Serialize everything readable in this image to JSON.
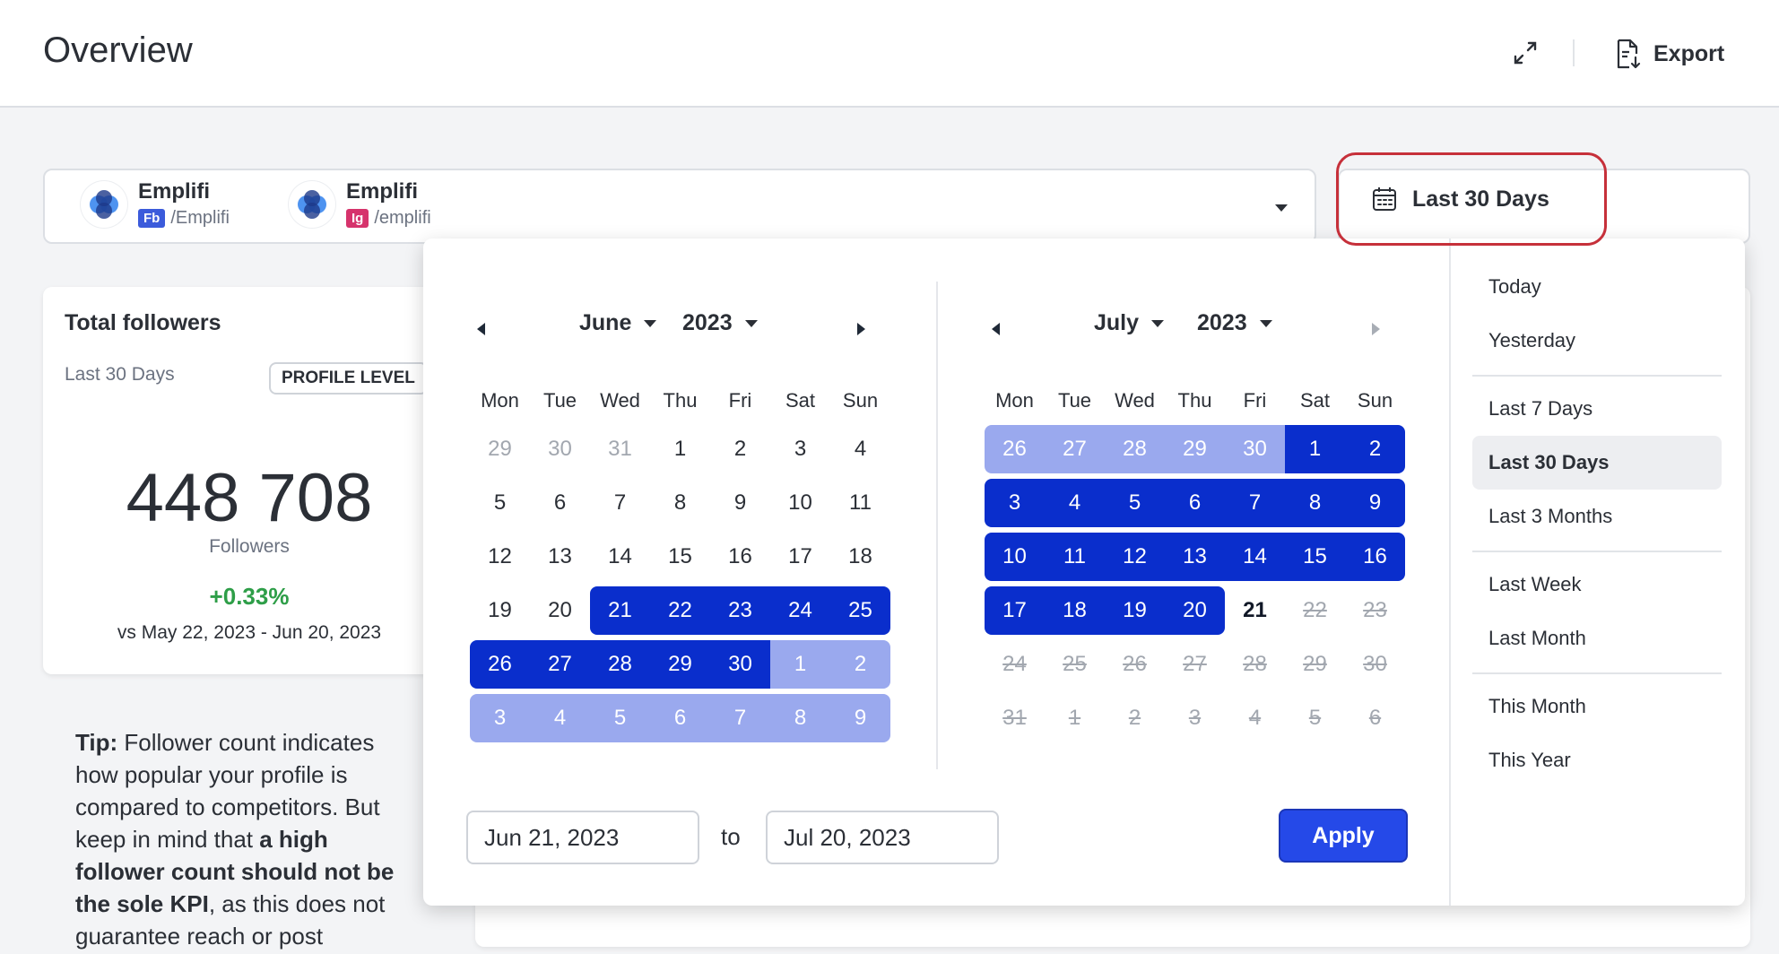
{
  "header": {
    "title": "Overview",
    "export_label": "Export"
  },
  "profiles": [
    {
      "name": "Emplifi",
      "network": "Fb",
      "network_color": "#3b5bdb",
      "handle": "/Emplifi"
    },
    {
      "name": "Emplifi",
      "network": "Ig",
      "network_color": "#d6336c",
      "handle": "/emplifi"
    }
  ],
  "date_range": {
    "label": "Last 30 Days"
  },
  "followers_card": {
    "title": "Total followers",
    "period": "Last 30 Days",
    "level_badge": "PROFILE LEVEL",
    "value": "448 708",
    "value_label": "Followers",
    "change": "+0.33%",
    "compare": "vs May 22, 2023 - Jun 20, 2023"
  },
  "tip": {
    "prefix": "Tip:",
    "part1": " Follower count indicates how popular your profile is compared to competitors. But keep in mind that ",
    "bold": "a high follower count should not be the sole KPI",
    "part2": ", as this does not guarantee reach or post"
  },
  "calendar": {
    "weekdays": [
      "Mon",
      "Tue",
      "Wed",
      "Thu",
      "Fri",
      "Sat",
      "Sun"
    ],
    "left": {
      "month": "June",
      "year": "2023",
      "weeks": [
        [
          [
            "29",
            "muted"
          ],
          [
            "30",
            "muted"
          ],
          [
            "31",
            "muted"
          ],
          [
            "1",
            "norm"
          ],
          [
            "2",
            "norm"
          ],
          [
            "3",
            "norm"
          ],
          [
            "4",
            "norm"
          ]
        ],
        [
          [
            "5",
            "norm"
          ],
          [
            "6",
            "norm"
          ],
          [
            "7",
            "norm"
          ],
          [
            "8",
            "norm"
          ],
          [
            "9",
            "norm"
          ],
          [
            "10",
            "norm"
          ],
          [
            "11",
            "norm"
          ]
        ],
        [
          [
            "12",
            "norm"
          ],
          [
            "13",
            "norm"
          ],
          [
            "14",
            "norm"
          ],
          [
            "15",
            "norm"
          ],
          [
            "16",
            "norm"
          ],
          [
            "17",
            "norm"
          ],
          [
            "18",
            "norm"
          ]
        ],
        [
          [
            "19",
            "norm"
          ],
          [
            "20",
            "norm"
          ],
          [
            "21",
            "s"
          ],
          [
            "22",
            "s"
          ],
          [
            "23",
            "s"
          ],
          [
            "24",
            "s"
          ],
          [
            "25",
            "s"
          ]
        ],
        [
          [
            "26",
            "s"
          ],
          [
            "27",
            "s"
          ],
          [
            "28",
            "s"
          ],
          [
            "29",
            "s"
          ],
          [
            "30",
            "s"
          ],
          [
            "1",
            "l"
          ],
          [
            "2",
            "l"
          ]
        ],
        [
          [
            "3",
            "l"
          ],
          [
            "4",
            "l"
          ],
          [
            "5",
            "l"
          ],
          [
            "6",
            "l"
          ],
          [
            "7",
            "l"
          ],
          [
            "8",
            "l"
          ],
          [
            "9",
            "l"
          ]
        ]
      ]
    },
    "right": {
      "month": "July",
      "year": "2023",
      "weeks": [
        [
          [
            "26",
            "l"
          ],
          [
            "27",
            "l"
          ],
          [
            "28",
            "l"
          ],
          [
            "29",
            "l"
          ],
          [
            "30",
            "l"
          ],
          [
            "1",
            "s"
          ],
          [
            "2",
            "s"
          ]
        ],
        [
          [
            "3",
            "s"
          ],
          [
            "4",
            "s"
          ],
          [
            "5",
            "s"
          ],
          [
            "6",
            "s"
          ],
          [
            "7",
            "s"
          ],
          [
            "8",
            "s"
          ],
          [
            "9",
            "s"
          ]
        ],
        [
          [
            "10",
            "s"
          ],
          [
            "11",
            "s"
          ],
          [
            "12",
            "s"
          ],
          [
            "13",
            "s"
          ],
          [
            "14",
            "s"
          ],
          [
            "15",
            "s"
          ],
          [
            "16",
            "s"
          ]
        ],
        [
          [
            "17",
            "s"
          ],
          [
            "18",
            "s"
          ],
          [
            "19",
            "s"
          ],
          [
            "20",
            "s"
          ],
          [
            "21",
            "today"
          ],
          [
            "22",
            "x"
          ],
          [
            "23",
            "x"
          ]
        ],
        [
          [
            "24",
            "x"
          ],
          [
            "25",
            "x"
          ],
          [
            "26",
            "x"
          ],
          [
            "27",
            "x"
          ],
          [
            "28",
            "x"
          ],
          [
            "29",
            "x"
          ],
          [
            "30",
            "x"
          ]
        ],
        [
          [
            "31",
            "x"
          ],
          [
            "1",
            "x"
          ],
          [
            "2",
            "x"
          ],
          [
            "3",
            "x"
          ],
          [
            "4",
            "x"
          ],
          [
            "5",
            "x"
          ],
          [
            "6",
            "x"
          ]
        ]
      ]
    },
    "from_value": "Jun 21, 2023",
    "to_label": "to",
    "to_value": "Jul 20, 2023",
    "apply_label": "Apply"
  },
  "presets": [
    [
      "Today",
      "Yesterday"
    ],
    [
      "Last 7 Days",
      "Last 30 Days",
      "Last 3 Months"
    ],
    [
      "Last Week",
      "Last Month"
    ],
    [
      "This Month",
      "This Year"
    ]
  ],
  "active_preset": "Last 30 Days",
  "colors": {
    "selected": "#0a2ecc",
    "selected_light": "#9aa9ee",
    "apply": "#2549e8",
    "highlight": "#c6303a",
    "positive": "#2e9e48"
  }
}
